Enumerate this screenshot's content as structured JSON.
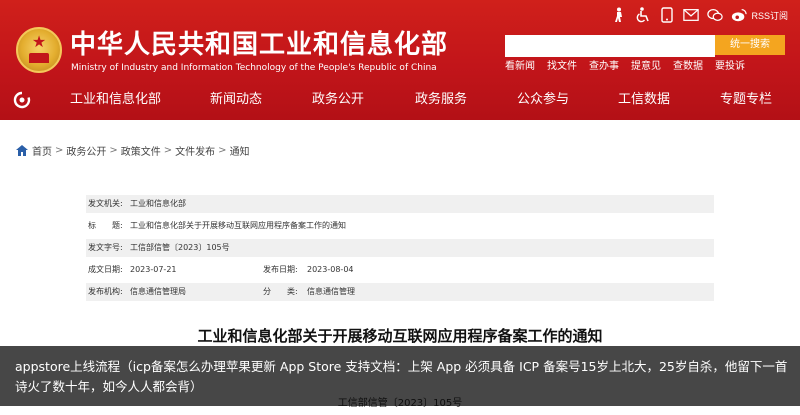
{
  "header": {
    "title": "中华人民共和国工业和信息化部",
    "subtitle": "Ministry of Industry and Information Technology of the People's Republic of China",
    "rss_label": "RSS订阅",
    "search": {
      "placeholder": "",
      "button": "统一搜索"
    },
    "quick_links": [
      "看新闻",
      "找文件",
      "查办事",
      "提意见",
      "查数据",
      "要投诉"
    ]
  },
  "nav": {
    "items": [
      "工业和信息化部",
      "新闻动态",
      "政务公开",
      "政务服务",
      "公众参与",
      "工信数据",
      "专题专栏"
    ]
  },
  "breadcrumb": {
    "items": [
      "首页",
      "政务公开",
      "政策文件",
      "文件发布",
      "通知"
    ],
    "separator": ">"
  },
  "info": {
    "issuer_label": "发文机关:",
    "issuer": "工业和信息化部",
    "title_label": "标　　题:",
    "title": "工业和信息化部关于开展移动互联网应用程序备案工作的通知",
    "docno_label": "发文字号:",
    "docno": "工信部信管〔2023〕105号",
    "date_label": "成文日期:",
    "date": "2023-07-21",
    "pub_label": "发布日期:",
    "pub_date": "2023-08-04",
    "org_label": "发布机构:",
    "org": "信息通信管理局",
    "cat_label": "分　　类:",
    "category": "信息通信管理"
  },
  "document": {
    "title": "工业和信息化部关于开展移动互联网应用程序备案工作的通知",
    "number": "工信部信管〔2023〕105号"
  },
  "overlay": {
    "caption": "appstore上线流程（icp备案怎么办理苹果更新 App Store 支持文档：上架 App 必须具备 ICP 备案号15岁上北大，25岁自杀，他留下一首诗火了数十年，如今人人都会背）"
  },
  "colors": {
    "header_red": "#c2151a",
    "search_button": "#f4a51f",
    "overlay": "#000000"
  },
  "icons": [
    "weibo-icon",
    "wechat-icon",
    "mail-icon",
    "mobile-icon",
    "accessibility-icon",
    "elderly-icon",
    "home-icon",
    "emblem"
  ]
}
